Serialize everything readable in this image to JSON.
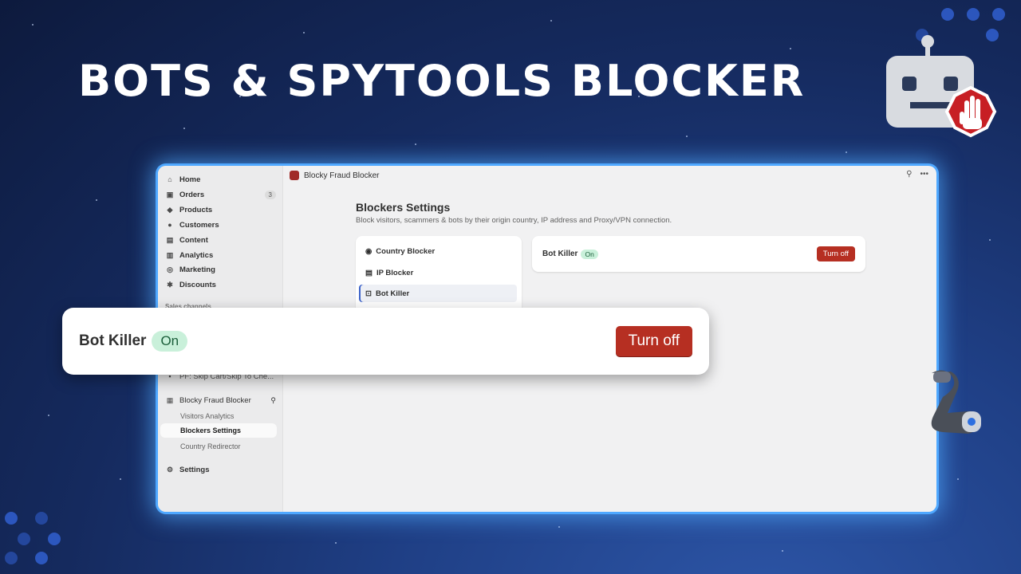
{
  "hero": {
    "title": "BOTS & SPYTOOLS BLOCKER"
  },
  "topbar": {
    "app_name": "Blocky Fraud Blocker"
  },
  "sidebar": {
    "items": [
      {
        "label": "Home",
        "icon": "home-icon"
      },
      {
        "label": "Orders",
        "icon": "orders-icon",
        "badge": "3"
      },
      {
        "label": "Products",
        "icon": "tag-icon"
      },
      {
        "label": "Customers",
        "icon": "person-icon"
      },
      {
        "label": "Content",
        "icon": "content-icon"
      },
      {
        "label": "Analytics",
        "icon": "bar-chart-icon"
      },
      {
        "label": "Marketing",
        "icon": "target-icon"
      },
      {
        "label": "Discounts",
        "icon": "discount-icon"
      }
    ],
    "sales_channels_label": "Sales channels",
    "truncated_app": "PF: Skip Cart/Skip To Che...",
    "app": {
      "label": "Blocky Fraud Blocker"
    },
    "sub_items": [
      "Visitors Analytics",
      "Blockers Settings",
      "Country Redirector"
    ],
    "settings_label": "Settings"
  },
  "main": {
    "title": "Blockers Settings",
    "subtitle": "Block visitors, scammers & bots by their origin country, IP address and Proxy/VPN connection.",
    "tabs": [
      {
        "label": "Country Blocker",
        "icon": "globe-icon"
      },
      {
        "label": "IP Blocker",
        "icon": "list-icon"
      },
      {
        "label": "Bot Killer",
        "icon": "bot-icon"
      }
    ],
    "status": {
      "label": "Bot Killer",
      "badge": "On",
      "button": "Turn off"
    }
  },
  "callout": {
    "label": "Bot Killer",
    "badge": "On",
    "button": "Turn off"
  },
  "colors": {
    "accent": "#b62f22",
    "glow": "#4fa8ff",
    "on_badge": "#c9f0da"
  }
}
